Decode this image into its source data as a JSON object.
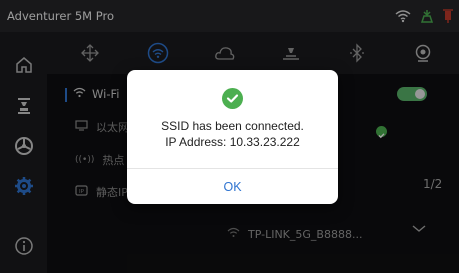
{
  "app": {
    "title": "Adventurer 5M Pro"
  },
  "status_icons": [
    "wifi-icon",
    "printer-status-icon",
    "filament-status-icon"
  ],
  "sidebar": {
    "items": [
      {
        "name": "home-icon"
      },
      {
        "name": "print-icon"
      },
      {
        "name": "fan-icon"
      },
      {
        "name": "settings-icon",
        "active": true
      },
      {
        "name": "info-icon"
      }
    ]
  },
  "tabs": [
    {
      "name": "move-axis-icon"
    },
    {
      "name": "wifi-settings-icon",
      "active": true
    },
    {
      "name": "cloud-icon"
    },
    {
      "name": "calibrate-icon"
    },
    {
      "name": "bluetooth-icon"
    },
    {
      "name": "camera-icon"
    }
  ],
  "network": {
    "wifi_label": "Wi-Fi",
    "ethernet_label": "以太网",
    "hotspot_label": "热点",
    "static_ip_label": "静态IP",
    "page_indicator": "1/2",
    "network_item": "TP-LINK_5G_B8888..."
  },
  "dialog": {
    "line1": "SSID has been connected.",
    "line2": "IP Address: 10.33.23.222",
    "ok_label": "OK"
  },
  "colors": {
    "accent": "#2f74d0",
    "success": "#4caf50",
    "toggle_on": "#5ab46a"
  }
}
